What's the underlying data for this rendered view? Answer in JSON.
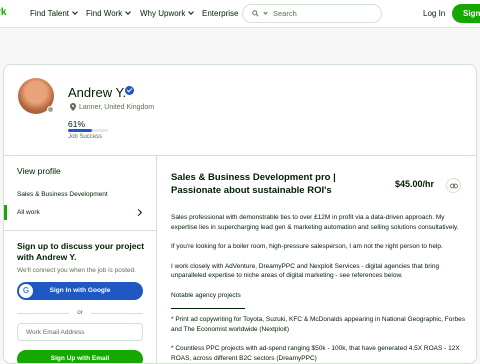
{
  "header": {
    "logo": "rk",
    "nav": [
      "Find Talent",
      "Find Work",
      "Why Upwork",
      "Enterprise"
    ],
    "search_placeholder": "Search",
    "login": "Log In",
    "signup": "Sign"
  },
  "profile": {
    "name": "Andrew Y.",
    "location": "Lanner, United Kingdom",
    "job_success_value": "61%",
    "job_success_fraction": 0.61,
    "job_success_label": "Job Success"
  },
  "sidebar": {
    "view_profile": "View profile",
    "items": [
      "Sales & Business Development",
      "All work"
    ],
    "cta_heading": "Sign up to discuss your project with Andrew Y.",
    "cta_subtext": "We'll connect you when the job is posted.",
    "google_button": "Sign In with Google",
    "or": "or",
    "email_placeholder": "Work Email Address",
    "email_button": "Sign Up with Email"
  },
  "main": {
    "title": "Sales & Business Development pro | Passionate about sustainable ROI's",
    "rate": "$45.00/hr",
    "overview": [
      "Sales professional with demonstrable ties to over £12M in profit via a data-driven approach. My expertise lies in supercharging lead gen & marketing automation and selling solutions consultatively.",
      "If you're looking for a boiler room, high-pressure salesperson, I am not the right person to help.",
      "I work closely with AdVenture, DreamyPPC and Nexploit Services - digital agencies that bring unparalleled expertise to niche areas of digital marketing - see references below.",
      "Notable agency projects",
      "* Print ad copywriting for Toyota, Suzuki, KFC & McDonalds appearing in National Geographic, Forbes and The Economist worldwide (Nextploit)",
      "* Countless PPC projects with ad-spend ranging $50k - 100k, that have generated 4.5X ROAS - 12X ROAS, across different B2C sectors (DreamyPPC)"
    ]
  },
  "colors": {
    "brand": "#14a800",
    "accent": "#1f57c3",
    "text": "#001e00",
    "muted": "#5e6d55"
  }
}
